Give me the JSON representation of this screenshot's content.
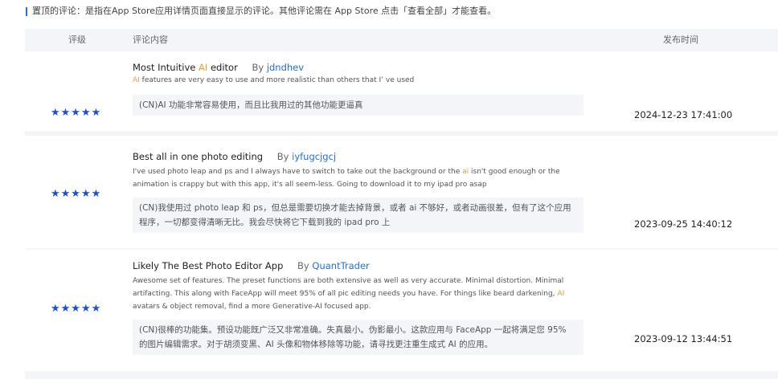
{
  "notice": "置顶的评论：是指在App Store应用详情页面直接显示的评论。其他评论需在 App Store 点击「查看全部」才能查看。",
  "columns": {
    "rating": "评级",
    "content": "评论内容",
    "date": "发布时间"
  },
  "colors": {
    "accent": "#1f6fe5",
    "highlight": "#e8a038",
    "stars": "#1d4fd8",
    "panel": "#f4f5f9"
  },
  "reviews": [
    {
      "stars": "★★★★★",
      "title_a": "Most Intuitive ",
      "title_hl": "AI",
      "title_b": " editor",
      "by": "By",
      "author": "jdndhev",
      "body_hl": "AI",
      "body": " features are very easy to use and more realistic than others that I’ ve used",
      "translation": "(CN)AI 功能非常容易使用，而且比我用过的其他功能更逼真",
      "date": "2024-12-23 17:41:00"
    },
    {
      "stars": "★★★★★",
      "title": "Best all in one photo editing",
      "by": "By",
      "author": "iyfugcjgcj",
      "body_a": "I've used photo leap and ps and I always have to switch to take out the background or the ",
      "body_hl": "ai",
      "body_b": " isn't good enough or the animation is crappy but with this app, it's all seem-less. Going to download it to my ipad pro asap",
      "translation": "(CN)我使用过 photo leap 和 ps，但总是需要切换才能去掉背景，或者 ai 不够好，或者动画很差，但有了这个应用程序，一切都变得清晰无比。我会尽快将它下载到我的 ipad pro 上",
      "date": "2023-09-25 14:40:12"
    },
    {
      "stars": "★★★★★",
      "title": "Likely The Best Photo Editor App",
      "by": "By",
      "author": "QuantTrader",
      "body_a": "Awesome set of features. The preset functions are both extensive as well as very accurate. Minimal distortion. Minimal artifacting. This along with FaceApp will meet 95% of all pic editing needs you have. For things like beard darkening, ",
      "body_hl": "AI",
      "body_b": " avatars & object removal, find a more Generative-AI focused app.",
      "translation": "(CN)很棒的功能集。预设功能既广泛又非常准确。失真最小。伪影最小。这款应用与 FaceApp 一起将满足您 95% 的图片编辑需求。对于胡须变黑、AI 头像和物体移除等功能，请寻找更注重生成式 AI 的应用。",
      "date": "2023-09-12 13:44:51"
    }
  ]
}
